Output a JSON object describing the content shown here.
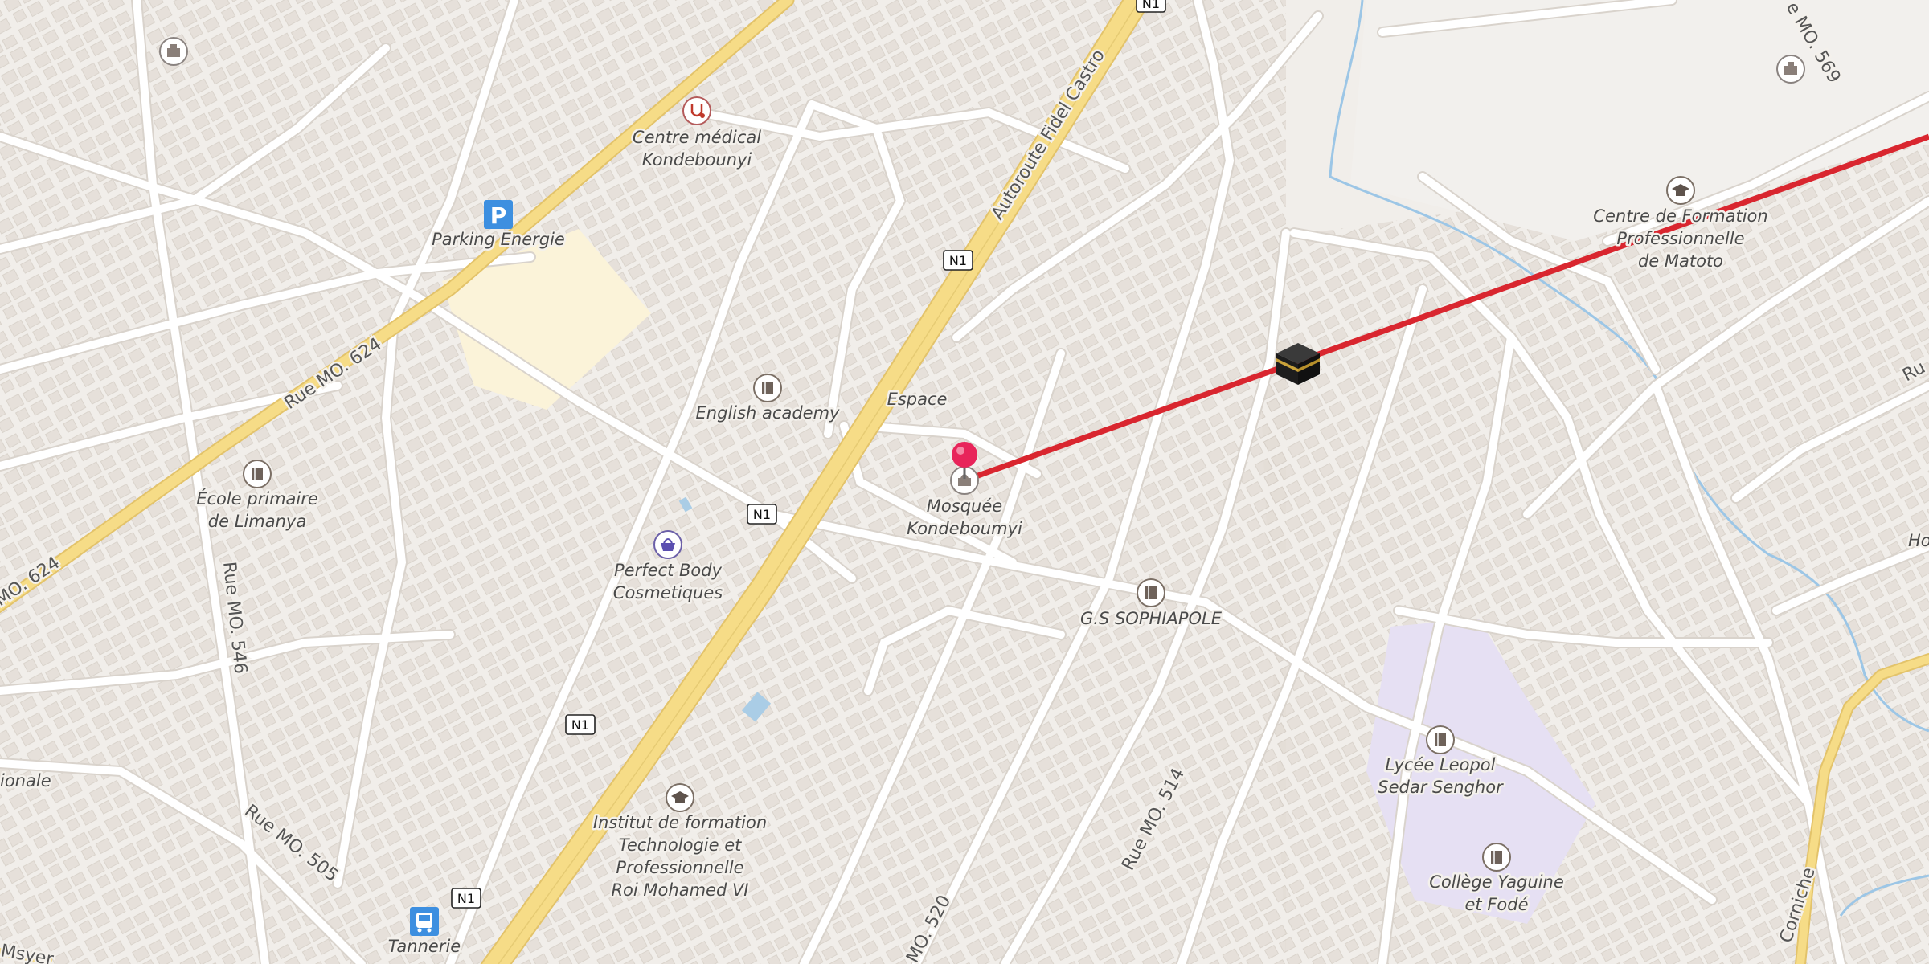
{
  "map": {
    "shield_label": "N1",
    "roads": {
      "rue_mo_624": "Rue MO. 624",
      "rue_mo_624_b": "MO. 624",
      "autoroute": "Autoroute Fidel Castro",
      "rue_mo_546": "Rue MO. 546",
      "rue_mo_505": "Rue MO. 505",
      "rue_mo_514": "Rue MO. 514",
      "rue_mo_520": "MO. 520",
      "rue_mo_569": "e MO. 569",
      "corniche": "Corniche",
      "edge_left_bottom": "Msyer",
      "edge_left_mid": "ionale",
      "edge_right_ru": "Ru",
      "edge_right_ho": "Ho"
    },
    "pois": {
      "centre_medical_1": "Centre médical",
      "centre_medical_2": "Kondebounyi",
      "parking": "Parking Energie",
      "english_academy": "English academy",
      "espace": "Espace",
      "mosquee_1": "Mosquée",
      "mosquee_2": "Kondeboumyi",
      "ecole_1": "École primaire",
      "ecole_2": "de Limanya",
      "perfect_1": "Perfect Body",
      "perfect_2": "Cosmetiques",
      "sophiapole": "G.S SOPHIAPOLE",
      "lycee_1": "Lycée Leopol",
      "lycee_2": "Sedar Senghor",
      "college_1": "Collège Yaguine",
      "college_2": "et Fodé",
      "institut_1": "Institut de formation",
      "institut_2": "Technologie et",
      "institut_3": "Professionnelle",
      "institut_4": "Roi Mohamed VI",
      "centre_formation_1": "Centre de Formation",
      "centre_formation_2": "Professionnelle",
      "centre_formation_3": "de Matoto",
      "tannerie": "Tannerie"
    },
    "icons": {
      "parking_glyph": "P",
      "qibla": "kaaba-icon",
      "pin": "location-pin-icon"
    },
    "colors": {
      "background": "#f1eeea",
      "motorway": "#f3d77e",
      "qibla_line": "#d9262f",
      "pin": "#e8245a",
      "water": "#9cc6e6",
      "school_area": "#e6e0f3",
      "parking_area": "#fbf3d9"
    }
  }
}
